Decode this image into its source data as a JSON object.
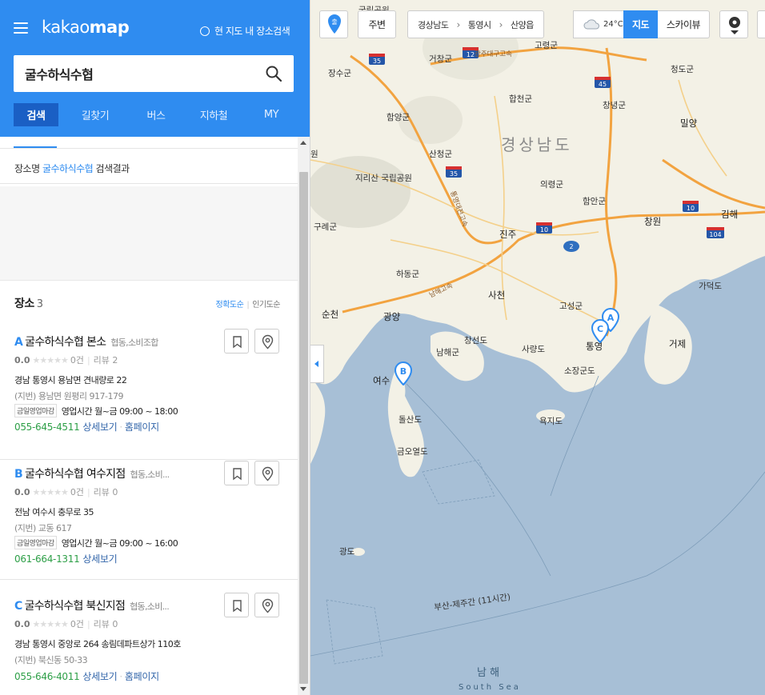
{
  "app": {
    "logo_light": "kakao",
    "logo_bold": "map",
    "here_search": "현 지도 내 장소검색"
  },
  "search": {
    "query": "굴수하식수협"
  },
  "tabs": [
    "검색",
    "길찾기",
    "버스",
    "지하철",
    "MY"
  ],
  "active_tab": "검색",
  "result_header": {
    "prefix": "장소명",
    "keyword": "굴수하식수협",
    "suffix": "검색결과"
  },
  "places": {
    "label": "장소",
    "count": "3",
    "sort_accuracy": "정확도순",
    "sort_popular": "인기도순",
    "items": [
      {
        "marker": "A",
        "name": "굴수하식수협 본소",
        "category": "협동,소비조합",
        "rating": "0.0",
        "stars": "★★★★★",
        "rating_count": "0건",
        "review": "리뷰 2",
        "address": "경남 통영시 용남면 견내량로 22",
        "jibun": "(지번) 용남면 원평리 917-179",
        "hours_tag": "금일영업마감",
        "hours": "영업시간 월~금 09:00 ~ 18:00",
        "phone": "055-645-4511",
        "detail": "상세보기",
        "homepage": "홈페이지"
      },
      {
        "marker": "B",
        "name": "굴수하식수협 여수지점",
        "category": "협동,소비...",
        "rating": "0.0",
        "stars": "★★★★★",
        "rating_count": "0건",
        "review": "리뷰 0",
        "address": "전남 여수시 충무로 35",
        "jibun": "(지번) 교동 617",
        "hours_tag": "금일영업마감",
        "hours": "영업시간 월~금 09:00 ~ 16:00",
        "phone": "061-664-1311",
        "detail": "상세보기",
        "homepage": ""
      },
      {
        "marker": "C",
        "name": "굴수하식수협 북신지점",
        "category": "협동,소비...",
        "rating": "0.0",
        "stars": "★★★★★",
        "rating_count": "0건",
        "review": "리뷰 0",
        "address": "경남 통영시 중앙로 264 송림데파트상가 110호",
        "jibun": "(지번) 북신동 50-33",
        "hours_tag": "",
        "hours": "",
        "phone": "055-646-4011",
        "detail": "상세보기",
        "homepage": "홈페이지"
      }
    ]
  },
  "map_toolbar": {
    "origin_btn": "출",
    "nearby": "주변",
    "breadcrumb": [
      "경상남도",
      "통영시",
      "산양읍"
    ],
    "temperature": "24°C",
    "view_map": "지도",
    "view_sky": "스카이뷰"
  },
  "map_labels": {
    "province": "경상남도",
    "sea_name": "남 해",
    "sea_name_en": "South Sea",
    "ferry_route": "부산-제주간 (11시간)",
    "places": [
      "국립공원",
      "고령군",
      "장수군",
      "거창군",
      "청도군",
      "합천군",
      "창녕군",
      "함양군",
      "밀양",
      "산청군",
      "지리산 국립공원",
      "의령군",
      "함안군",
      "창원",
      "김해",
      "구례군",
      "진주",
      "하동군",
      "가덕도",
      "사천",
      "고성군",
      "순천",
      "광양",
      "창선도",
      "거제",
      "사량도",
      "통영",
      "남해군",
      "소장군도",
      "여수",
      "욕지도",
      "돌산도",
      "금오열도",
      "광도",
      "원"
    ],
    "roads": [
      "광주대구고속",
      "통영대전고속",
      "남해고속"
    ],
    "route_numbers": [
      "35",
      "12",
      "45",
      "35",
      "10",
      "2",
      "10",
      "104"
    ]
  },
  "colors": {
    "brand": "#2f8cf0",
    "brand_dark": "#1a5fc4",
    "sea": "#a7bfd6",
    "land": "#f3f1e6",
    "marker": "#2f8cf0"
  }
}
